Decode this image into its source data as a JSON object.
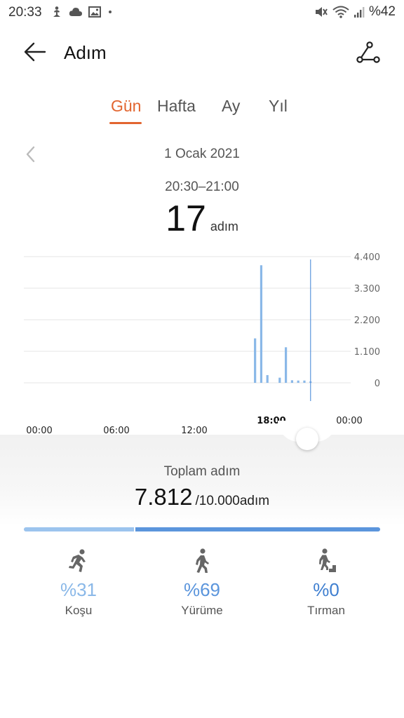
{
  "status_bar": {
    "time": "20:33",
    "battery": "%42",
    "left_icons": [
      "fitness-notification-icon",
      "cloud-icon",
      "image-icon",
      "dot-icon"
    ],
    "right_icons": [
      "mute-icon",
      "wifi-icon",
      "signal-icon"
    ]
  },
  "app_bar": {
    "title": "Adım"
  },
  "tabs": [
    {
      "label": "Gün",
      "active": true
    },
    {
      "label": "Hafta",
      "active": false
    },
    {
      "label": "Ay",
      "active": false
    },
    {
      "label": "Yıl",
      "active": false
    }
  ],
  "date": "1 Ocak 2021",
  "selection": {
    "time_range": "20:30–21:00",
    "steps": "17",
    "unit": "adım"
  },
  "chart_data": {
    "type": "bar",
    "x": [
      "00:00",
      "06:00",
      "12:00",
      "18:00",
      "00:00"
    ],
    "x_highlight": "18:00",
    "y_ticks": [
      "4.400",
      "3.300",
      "2.200",
      "1.100",
      "0"
    ],
    "ylim": [
      0,
      4400
    ],
    "bar_color": "#8ab8e8",
    "bars": [
      {
        "hour": 17.5,
        "value": 1550
      },
      {
        "hour": 18.0,
        "value": 4100
      },
      {
        "hour": 18.5,
        "value": 270
      },
      {
        "hour": 19.5,
        "value": 180
      },
      {
        "hour": 20.0,
        "value": 1240
      },
      {
        "hour": 20.5,
        "value": 90
      },
      {
        "hour": 21.0,
        "value": 80
      },
      {
        "hour": 21.5,
        "value": 80
      },
      {
        "hour": 22.0,
        "value": 17
      }
    ],
    "selected_hour": 22.0
  },
  "summary": {
    "label": "Toplam adım",
    "total": "7.812",
    "goal": "/10.000adım",
    "segments": [
      {
        "name": "Koşu",
        "share": 0.31,
        "color": "#9cc4ee"
      },
      {
        "name": "Yürüme",
        "share": 0.69,
        "color": "#5b95dc"
      }
    ]
  },
  "activities": [
    {
      "label": "Koşu",
      "pct": "%31",
      "color": "#8ab8e8",
      "icon": "running-icon"
    },
    {
      "label": "Yürüme",
      "pct": "%69",
      "color": "#5b95dc",
      "icon": "walking-icon"
    },
    {
      "label": "Tırman",
      "pct": "%0",
      "color": "#3f7fd0",
      "icon": "climbing-icon"
    }
  ]
}
